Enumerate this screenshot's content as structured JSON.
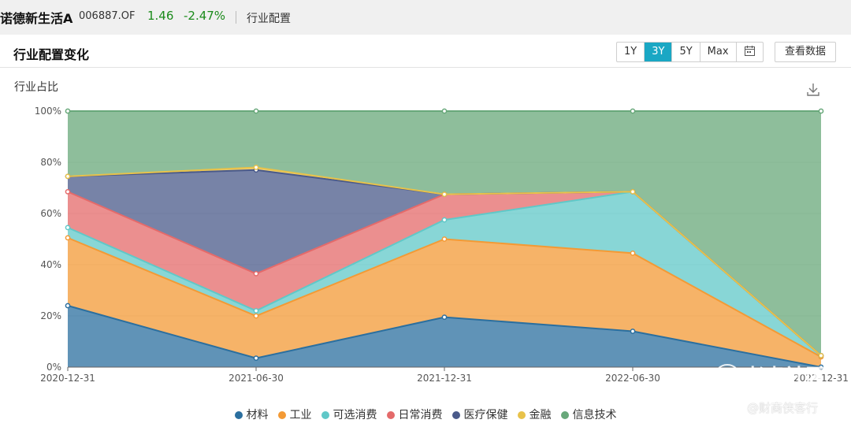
{
  "header": {
    "fund_name": "诺德新生活A",
    "fund_code": "006887.OF",
    "price": "1.46",
    "change": "-2.47%",
    "breadcrumb": "行业配置"
  },
  "card": {
    "title": "行业配置变化",
    "ranges": [
      "1Y",
      "3Y",
      "5Y",
      "Max"
    ],
    "active_range": "3Y",
    "view_data_label": "查看数据",
    "y_title": "行业占比"
  },
  "watermark": {
    "brand": "老虎社区",
    "handle": "@财商侠客行"
  },
  "chart_data": {
    "type": "area",
    "stacked": true,
    "categories": [
      "2020-12-31",
      "2021-06-30",
      "2021-12-31",
      "2022-06-30",
      "2022-12-31"
    ],
    "y_ticks": [
      "0%",
      "20%",
      "40%",
      "60%",
      "80%",
      "100%"
    ],
    "ylim": [
      0,
      100
    ],
    "legend_position": "bottom",
    "series": [
      {
        "name": "材料",
        "color": "#2b6f9f",
        "values": [
          24,
          3.5,
          19.5,
          14,
          0
        ]
      },
      {
        "name": "工业",
        "color": "#f39a35",
        "values": [
          26.5,
          16.5,
          30.5,
          30.5,
          4
        ]
      },
      {
        "name": "可选消费",
        "color": "#60c8c8",
        "values": [
          4,
          2,
          7.5,
          24,
          0.5
        ]
      },
      {
        "name": "日常消费",
        "color": "#e46a6a",
        "values": [
          14,
          14.5,
          10,
          0,
          0
        ]
      },
      {
        "name": "医疗保健",
        "color": "#4a5a8a",
        "values": [
          6,
          40.5,
          0,
          0,
          0
        ]
      },
      {
        "name": "金融",
        "color": "#e8c24a",
        "values": [
          0,
          1,
          0,
          0,
          0
        ]
      },
      {
        "name": "信息技术",
        "color": "#68a87a",
        "values": [
          25.5,
          22,
          32.5,
          31.5,
          95.5
        ]
      }
    ]
  }
}
